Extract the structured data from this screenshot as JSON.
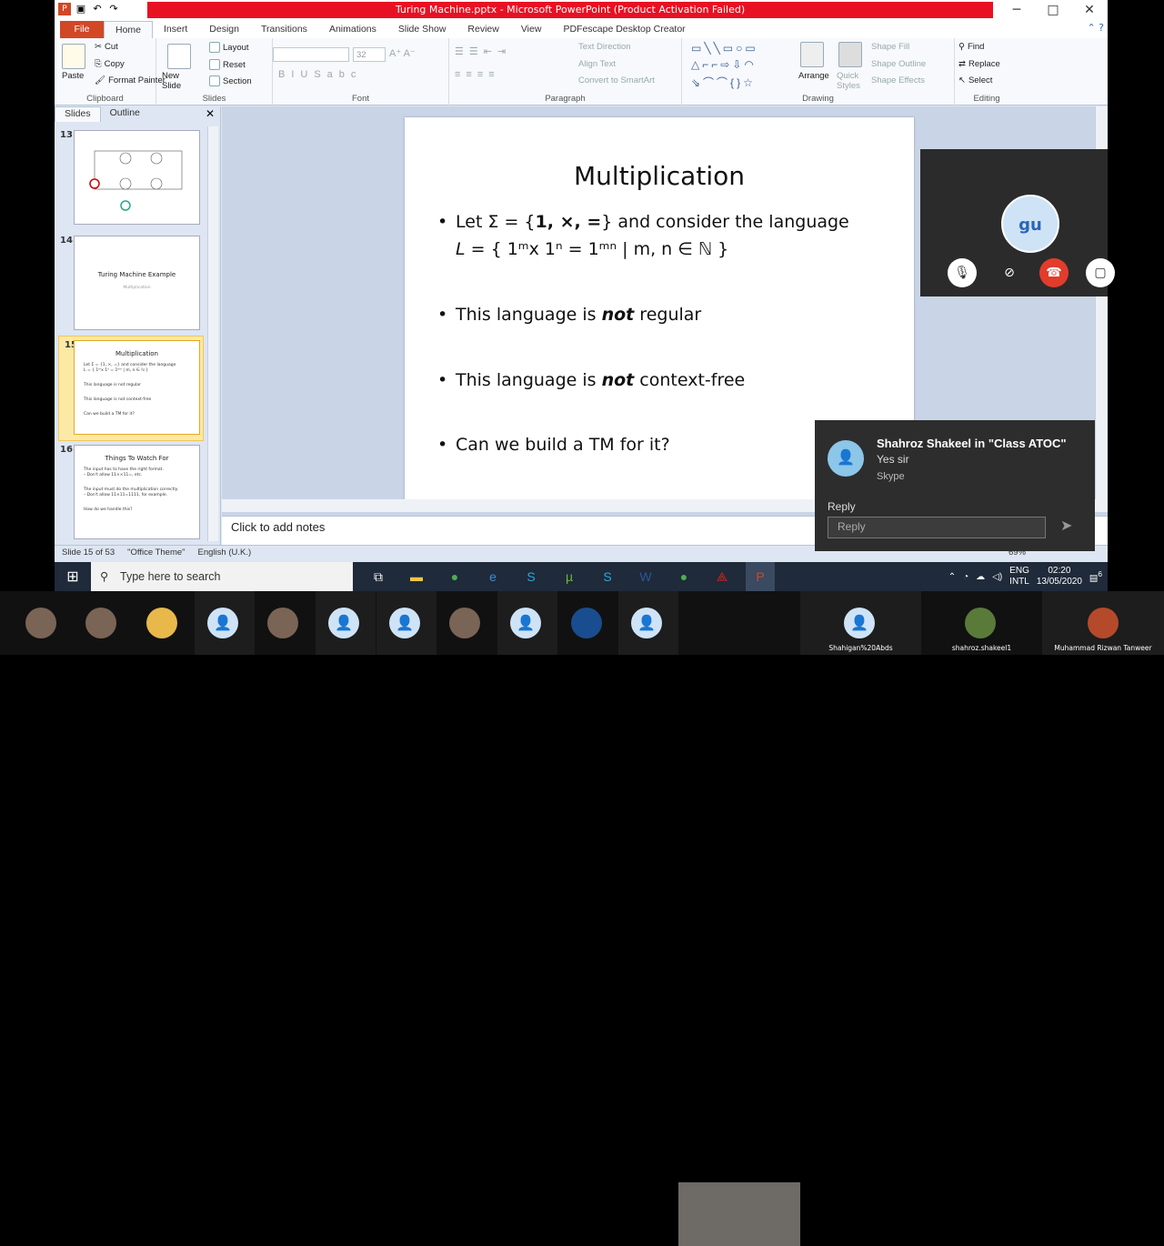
{
  "window": {
    "title": "Turing Machine.pptx  -  Microsoft PowerPoint (Product Activation Failed)",
    "controls": [
      "─",
      "□",
      "✕"
    ]
  },
  "tabs": [
    "File",
    "Home",
    "Insert",
    "Design",
    "Transitions",
    "Animations",
    "Slide Show",
    "Review",
    "View",
    "PDFescape Desktop Creator"
  ],
  "ribbon": {
    "clipboard": {
      "paste": "Paste",
      "cut": "Cut",
      "copy": "Copy",
      "format_painter": "Format Painter",
      "label": "Clipboard"
    },
    "slides": {
      "new_slide": "New Slide",
      "layout": "Layout",
      "reset": "Reset",
      "section": "Section",
      "label": "Slides"
    },
    "font": {
      "size": "32",
      "label": "Font"
    },
    "paragraph": {
      "text_direction": "Text Direction",
      "align_text": "Align Text",
      "smartart": "Convert to SmartArt",
      "label": "Paragraph"
    },
    "drawing": {
      "arrange": "Arrange",
      "quick_styles": "Quick Styles",
      "shape_fill": "Shape Fill",
      "shape_outline": "Shape Outline",
      "shape_effects": "Shape Effects",
      "label": "Drawing"
    },
    "editing": {
      "find": "Find",
      "replace": "Replace",
      "select": "Select",
      "label": "Editing"
    }
  },
  "panel": {
    "tabs": [
      "Slides",
      "Outline"
    ],
    "thumbs": [
      {
        "num": "13"
      },
      {
        "num": "14",
        "title": "Turing Machine Example",
        "sub": "Multiplication"
      },
      {
        "num": "15",
        "title": "Multiplication",
        "lines": [
          "Let Σ = {1, ×, =} and consider the language",
          "L = { 1ᵐx 1ⁿ = 1ᵐⁿ | m, n ∈ ℕ }",
          "This language is not regular",
          "This language is not context-free",
          "Can we build a TM for it?"
        ]
      },
      {
        "num": "16",
        "title": "Things To Watch For",
        "lines": [
          "The input has to have the right format.",
          "– Don't allow 11××11=, etc.",
          "The input must do the multiplication correctly.",
          "– Don't allow 11×11=1111, for example.",
          "How do we handle this?"
        ]
      }
    ]
  },
  "slide": {
    "title": "Multiplication",
    "b1a": "Let Σ = {",
    "b1_sym": "1, ×, =",
    "b1b": "} and consider the language",
    "b1_lang_pre": "L",
    "b1_lang": " = { 1ᵐx 1ⁿ = 1ᵐⁿ | m, n ∈ ℕ }",
    "b2_pre": "This language is ",
    "b2_em": "not",
    "b2_post": " regular",
    "b3_pre": "This language is ",
    "b3_em": "not",
    "b3_post": " context-free",
    "b4": "Can we build a TM for it?"
  },
  "notes": "Click to add notes",
  "status": {
    "slide": "Slide 15 of 53",
    "theme": "\"Office Theme\"",
    "lang": "English (U.K.)",
    "zoom": "69%"
  },
  "call": {
    "initials": "gu"
  },
  "toast": {
    "title": "Shahroz Shakeel in \"Class ATOC\"",
    "message": "Yes sir",
    "app": "Skype",
    "reply_label": "Reply",
    "reply_placeholder": "Reply"
  },
  "taskbar": {
    "search": "Type here to search",
    "lang1": "ENG",
    "lang2": "INTL",
    "time": "02:20",
    "date": "13/05/2020",
    "notif": "6"
  },
  "participants": [
    "Shahigan%20Abds",
    "shahroz.shakeel1",
    "Muhammad Rizwan Tanweer"
  ],
  "colors": {
    "accent": "#d24726",
    "title_red": "#e81123",
    "selected": "#fce9a6"
  }
}
